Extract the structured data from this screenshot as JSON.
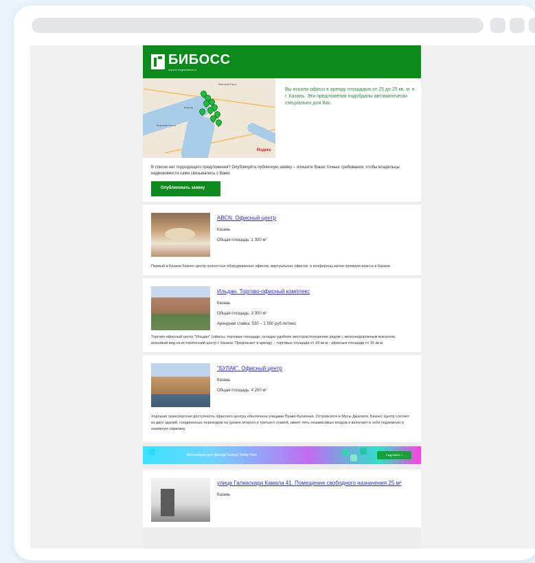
{
  "logo": {
    "name": "БИБОСС",
    "sub": "портал недвижимости"
  },
  "intro": {
    "map_text": "Вы искали офисы в аренду площадью от 25 до 25 кв. м. в г. Казань. Эти предложения подобраны автоматически специально для Вас.",
    "map_labels": [
      "Высокая Гора",
      "Казань",
      "Верхний Услон"
    ],
    "map_brand": "Яндекс",
    "text": "В списке нет подходящего предложения? Опубликуйте публичную заявку – опишите Ваши точные требования, чтобы владельцы недвижимости сами связывались с Вами.",
    "button": "Опубликовать заявку"
  },
  "listings": [
    {
      "title": "АВСN. Офисный центр",
      "city": "Казань",
      "area": "Общая площадь: 1 300 м²",
      "price": "",
      "description": "Первый в Казани бизнес-центр полностью оборудованных офисов, виртуальных офисов, и конференц-залов премиум-класса в Казани."
    },
    {
      "title": "Ильдан. Торгово-офисный комплекс",
      "city": "Казань",
      "area": "Общая площадь: 3 300 м²",
      "price": "Арендная ставка: 530 – 1 550 руб./м²/мес",
      "description": "Торгово-офисный центр \"Ильдан\" (офисы, торговые площади, складах удобное месторасположение рядом с железнодорожным вокзалом, красивый вид на исторический центр г. Казани. Предлагает в аренду: - торговые площади от 18 кв.м - офисные площади от 15 кв.м"
    },
    {
      "title": "\"БУЛАК\". Офисный центр",
      "city": "Казань",
      "area": "Общая площадь: 4 200 м²",
      "price": "",
      "description": "Хорошая транспортная доступность офисного центра обеспечена улицами Право-Булачная, Островского и Мусы Джалиля. Бизнес Центр состоит из двух зданий, соединенных переходом на уровне второго и третьего этажей, имеет пять независимых входов и включает в себя подземную и наземную парковку."
    },
    {
      "title": "улица Галиаскара Камала 41. Помещение свободного назначения 25 м²",
      "city": "Казань",
      "area": "",
      "price": "",
      "description": ""
    }
  ],
  "banner": {
    "text": "Вентиляция для фасада Kazany Teddy Here",
    "button": "Подробнее >"
  }
}
